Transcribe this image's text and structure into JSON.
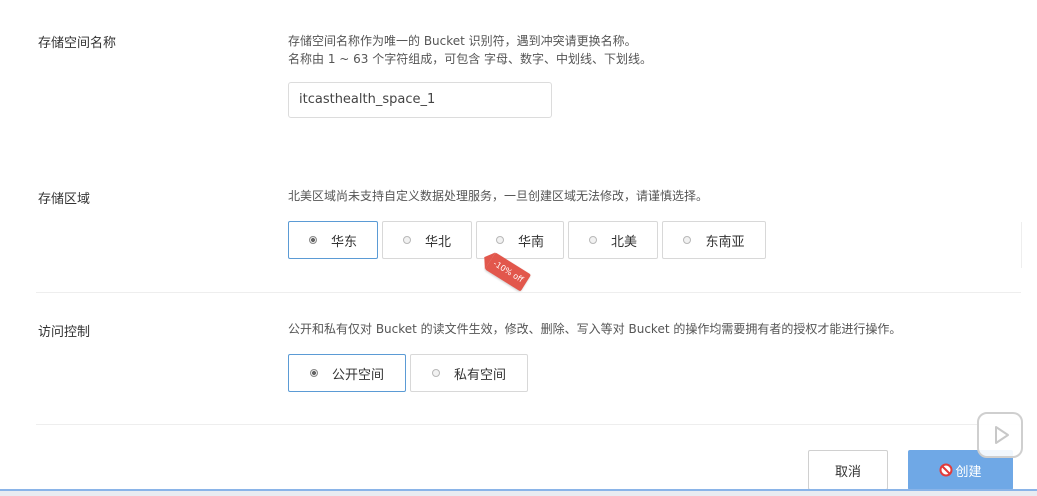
{
  "bucket_name": {
    "label": "存储空间名称",
    "desc_line1": "存储空间名称作为唯一的 Bucket 识别符，遇到冲突请更换名称。",
    "desc_line2": "名称由 1 ~ 63 个字符组成，可包含 字母、数字、中划线、下划线。",
    "value": "itcasthealth_space_1"
  },
  "region": {
    "label": "存储区域",
    "desc": "北美区域尚未支持自定义数据处理服务，一旦创建区域无法修改，请谨慎选择。",
    "options": [
      "华东",
      "华北",
      "华南",
      "北美",
      "东南亚"
    ],
    "selected": "华东",
    "promo_tag": "-10% off"
  },
  "access": {
    "label": "访问控制",
    "desc": "公开和私有仅对 Bucket 的读文件生效，修改、删除、写入等对 Bucket 的操作均需要拥有者的授权才能进行操作。",
    "options": [
      "公开空间",
      "私有空间"
    ],
    "selected": "公开空间"
  },
  "footer": {
    "cancel_label": "取消",
    "create_label": "创建"
  },
  "colors": {
    "accent": "#5b9bd5",
    "create_button": "#6fa8e6",
    "promo": "#e2574c"
  }
}
